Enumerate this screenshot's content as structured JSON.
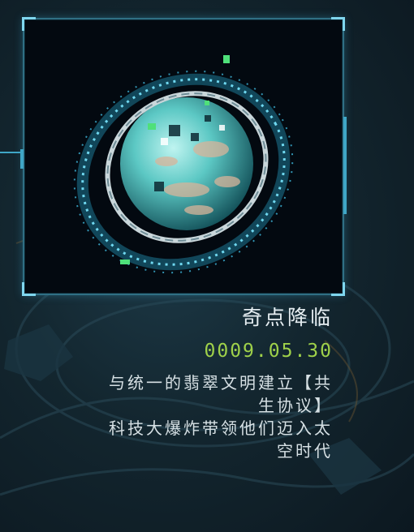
{
  "event": {
    "title": "奇点降临",
    "date": "0009.05.30",
    "description_lines": [
      "与统一的翡翠文明建立【共",
      "生协议】",
      "科技大爆炸带领他们迈入太",
      "空时代"
    ]
  },
  "image": {
    "icon": "planet-with-rings-icon"
  },
  "colors": {
    "frame_border": "#2f6f84",
    "date_green": "#9fd14a",
    "text_white": "#e6eef2",
    "ring_cyan": "#6fd8f0"
  }
}
